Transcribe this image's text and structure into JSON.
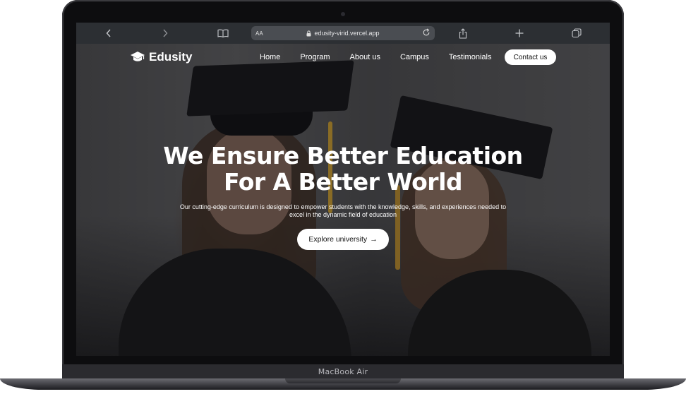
{
  "device": {
    "label": "MacBook Air"
  },
  "browser": {
    "text_size_label": "AA",
    "url": "edusity-virid.vercel.app",
    "icons": [
      "back-icon",
      "forward-icon",
      "book-icon",
      "lock-icon",
      "reload-icon",
      "share-icon",
      "plus-icon",
      "tabs-icon"
    ]
  },
  "site": {
    "brand": "Edusity",
    "nav": [
      "Home",
      "Program",
      "About us",
      "Campus",
      "Testimonials"
    ],
    "contact_label": "Contact us",
    "hero": {
      "title_line1": "We Ensure Better Education",
      "title_line2": "For A Better World",
      "subtitle_line1": "Our cutting-edge curriculum is designed to empower students with the knowledge, skills, and experiences needed to",
      "subtitle_line2": "excel in the dynamic field of education",
      "cta_label": "Explore university",
      "cta_arrow": "→"
    }
  },
  "colors": {
    "frame": "#0d0d0f",
    "toolbar": "#2c2f33",
    "button_bg": "#ffffff"
  }
}
